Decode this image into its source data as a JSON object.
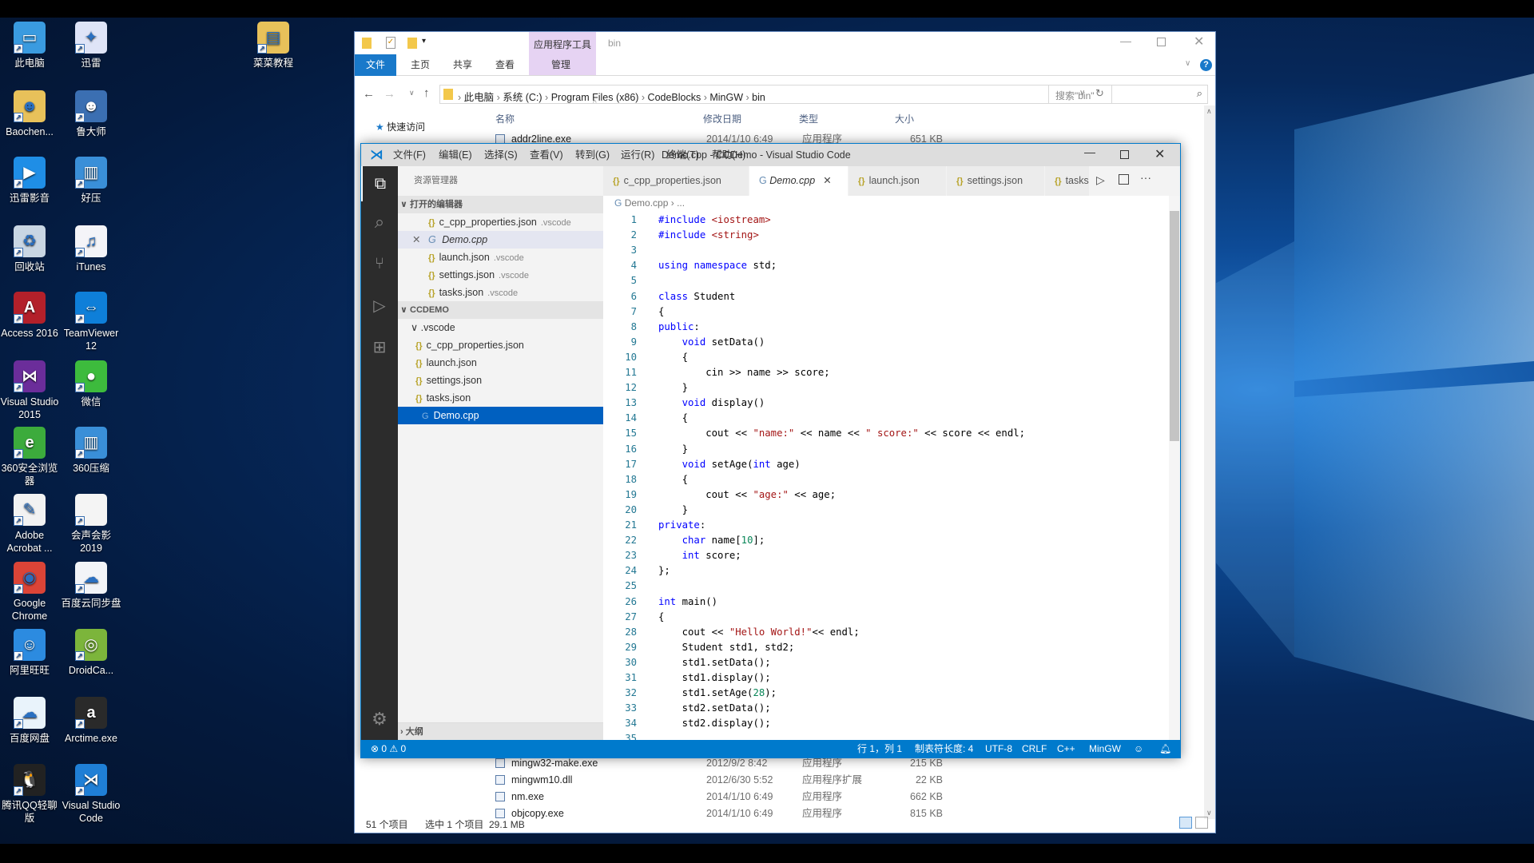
{
  "desktop": {
    "left_column": [
      {
        "label": "此电脑",
        "icon": "computer-icon",
        "color": "#3a9be0",
        "glyph": "▭"
      },
      {
        "label": "Baochen...",
        "icon": "user-folder-icon",
        "color": "#e8c15a",
        "glyph": "☻"
      },
      {
        "label": "迅雷影音",
        "icon": "xunlei-player-icon",
        "color": "#1f8ee6",
        "glyph": "▶"
      },
      {
        "label": "回收站",
        "icon": "recycle-bin-icon",
        "color": "#c9d6e3",
        "glyph": "♻"
      },
      {
        "label": "Access 2016",
        "icon": "access-icon",
        "color": "#b3202a",
        "glyph": "A"
      },
      {
        "label": "Visual Studio 2015",
        "icon": "visual-studio-icon",
        "color": "#6b2d9a",
        "glyph": "⋈"
      },
      {
        "label": "360安全浏览器",
        "icon": "360-browser-icon",
        "color": "#3cab3c",
        "glyph": "e"
      },
      {
        "label": "Adobe Acrobat ...",
        "icon": "acrobat-icon",
        "color": "#f2f2f2",
        "glyph": "✎"
      },
      {
        "label": "Google Chrome",
        "icon": "chrome-icon",
        "color": "#db4437",
        "glyph": "◉"
      },
      {
        "label": "阿里旺旺",
        "icon": "aliwangwang-icon",
        "color": "#2c8be0",
        "glyph": "☺"
      },
      {
        "label": "百度网盘",
        "icon": "baidu-netdisk-icon",
        "color": "#e9f3fb",
        "glyph": "☁"
      },
      {
        "label": "腾讯QQ轻聊版",
        "icon": "qq-icon",
        "color": "#222222",
        "glyph": "🐧"
      }
    ],
    "right_column": [
      {
        "label": "迅雷",
        "icon": "xunlei-icon",
        "color": "#dfe4f7",
        "glyph": "✦"
      },
      {
        "label": "鲁大师",
        "icon": "ludashi-icon",
        "color": "#3b6fb2",
        "glyph": "☻"
      },
      {
        "label": "好压",
        "icon": "haozip-icon",
        "color": "#3a8fd8",
        "glyph": "▥"
      },
      {
        "label": "iTunes",
        "icon": "itunes-icon",
        "color": "#f4f4f8",
        "glyph": "♫"
      },
      {
        "label": "TeamViewer 12",
        "icon": "teamviewer-icon",
        "color": "#0e7fd9",
        "glyph": "⇔"
      },
      {
        "label": "微信",
        "icon": "wechat-icon",
        "color": "#3dbb3d",
        "glyph": "●"
      },
      {
        "label": "360压缩",
        "icon": "360zip-icon",
        "color": "#3a8fd8",
        "glyph": "▥"
      },
      {
        "label": "会声会影 2019",
        "icon": "file-icon",
        "color": "#f4f4f4",
        "glyph": ""
      },
      {
        "label": "百度云同步盘",
        "icon": "baidu-sync-icon",
        "color": "#f2f4f8",
        "glyph": "☁"
      },
      {
        "label": "DroidCa...",
        "icon": "droidcam-icon",
        "color": "#7cb53b",
        "glyph": "◎"
      },
      {
        "label": "Arctime.exe",
        "icon": "arctime-icon",
        "color": "#2a2a2a",
        "glyph": "a"
      },
      {
        "label": "Visual Studio Code",
        "icon": "vscode-icon",
        "color": "#1f7fd6",
        "glyph": "⋊"
      }
    ],
    "extra": {
      "label": "菜菜教程",
      "icon": "folder-icon",
      "color": "#e8c15a",
      "glyph": "▤"
    }
  },
  "explorer": {
    "title": "bin",
    "context_tab": "应用程序工具",
    "ribbon_tabs": [
      "文件",
      "主页",
      "共享",
      "查看",
      "管理"
    ],
    "breadcrumb": [
      "此电脑",
      "系统 (C:)",
      "Program Files (x86)",
      "CodeBlocks",
      "MinGW",
      "bin"
    ],
    "search_placeholder": "搜索\"bin\"",
    "columns": [
      "名称",
      "修改日期",
      "类型",
      "大小"
    ],
    "nav": {
      "quick_access": "快速访问"
    },
    "rows_top": [
      {
        "name": "addr2line.exe",
        "date": "2014/1/10 6:49",
        "type": "应用程序",
        "size": "651 KB"
      }
    ],
    "rows_bottom": [
      {
        "name": "mingw32-make.exe",
        "date": "2012/9/2 8:42",
        "type": "应用程序",
        "size": "215 KB"
      },
      {
        "name": "mingwm10.dll",
        "date": "2012/6/30 5:52",
        "type": "应用程序扩展",
        "size": "22 KB"
      },
      {
        "name": "nm.exe",
        "date": "2014/1/10 6:49",
        "type": "应用程序",
        "size": "662 KB"
      },
      {
        "name": "objcopy.exe",
        "date": "2014/1/10 6:49",
        "type": "应用程序",
        "size": "815 KB"
      }
    ],
    "status": {
      "count": "51 个项目",
      "selected": "选中 1 个项目  29.1 MB"
    }
  },
  "vscode": {
    "title": "Demo.cpp - CCDemo - Visual Studio Code",
    "menu": [
      "文件(F)",
      "编辑(E)",
      "选择(S)",
      "查看(V)",
      "转到(G)",
      "运行(R)",
      "终端(T)",
      "帮助(H)"
    ],
    "sidebar": {
      "title": "资源管理器",
      "open_editors_header": "打开的编辑器",
      "open_editors": [
        {
          "name": "c_cpp_properties.json",
          "dir": ".vscode"
        },
        {
          "name": "Demo.cpp",
          "dir": ""
        },
        {
          "name": "launch.json",
          "dir": ".vscode"
        },
        {
          "name": "settings.json",
          "dir": ".vscode"
        },
        {
          "name": "tasks.json",
          "dir": ".vscode"
        }
      ],
      "folder_header": "CCDEMO",
      "subfolder": ".vscode",
      "files": [
        "c_cpp_properties.json",
        "launch.json",
        "settings.json",
        "tasks.json"
      ],
      "selected_file": "Demo.cpp",
      "outline_header": "大纲"
    },
    "tabs": [
      "c_cpp_properties.json",
      "Demo.cpp",
      "launch.json",
      "settings.json",
      "tasks.json"
    ],
    "active_tab": "Demo.cpp",
    "breadcrumb": [
      "Demo.cpp",
      "..."
    ],
    "code": [
      [
        [
          "pp",
          "#include"
        ],
        [
          "inc",
          " <iostream>"
        ]
      ],
      [
        [
          "pp",
          "#include"
        ],
        [
          "inc",
          " <string>"
        ]
      ],
      [],
      [
        [
          "kw",
          "using"
        ],
        [
          "",
          " "
        ],
        [
          "kw",
          "namespace"
        ],
        [
          "",
          " std;"
        ]
      ],
      [],
      [
        [
          "kw",
          "class"
        ],
        [
          "",
          " Student"
        ]
      ],
      [
        [
          "",
          "{"
        ]
      ],
      [
        [
          "kw",
          "public"
        ],
        [
          "",
          ":"
        ]
      ],
      [
        [
          "",
          "    "
        ],
        [
          "kw",
          "void"
        ],
        [
          "",
          " setData()"
        ]
      ],
      [
        [
          "",
          "    {"
        ]
      ],
      [
        [
          "",
          "        cin >> name >> score;"
        ]
      ],
      [
        [
          "",
          "    }"
        ]
      ],
      [
        [
          "",
          "    "
        ],
        [
          "kw",
          "void"
        ],
        [
          "",
          " display()"
        ]
      ],
      [
        [
          "",
          "    {"
        ]
      ],
      [
        [
          "",
          "        cout << "
        ],
        [
          "st",
          "\"name:\""
        ],
        [
          "",
          " << name << "
        ],
        [
          "st",
          "\" score:\""
        ],
        [
          "",
          " << score << endl;"
        ]
      ],
      [
        [
          "",
          "    }"
        ]
      ],
      [
        [
          "",
          "    "
        ],
        [
          "kw",
          "void"
        ],
        [
          "",
          " setAge("
        ],
        [
          "kw",
          "int"
        ],
        [
          "",
          " age)"
        ]
      ],
      [
        [
          "",
          "    {"
        ]
      ],
      [
        [
          "",
          "        cout << "
        ],
        [
          "st",
          "\"age:\""
        ],
        [
          "",
          " << age;"
        ]
      ],
      [
        [
          "",
          "    }"
        ]
      ],
      [
        [
          "kw",
          "private"
        ],
        [
          "",
          ":"
        ]
      ],
      [
        [
          "",
          "    "
        ],
        [
          "kw",
          "char"
        ],
        [
          "",
          " name["
        ],
        [
          "nm",
          "10"
        ],
        [
          "",
          "];"
        ]
      ],
      [
        [
          "",
          "    "
        ],
        [
          "kw",
          "int"
        ],
        [
          "",
          " score;"
        ]
      ],
      [
        [
          "",
          "};"
        ]
      ],
      [],
      [
        [
          "kw",
          "int"
        ],
        [
          "",
          " main()"
        ]
      ],
      [
        [
          "",
          "{"
        ]
      ],
      [
        [
          "",
          "    cout << "
        ],
        [
          "st",
          "\"Hello World!\""
        ],
        [
          "",
          "<< endl;"
        ]
      ],
      [
        [
          "",
          "    Student std1, std2;"
        ]
      ],
      [
        [
          "",
          "    std1.setData();"
        ]
      ],
      [
        [
          "",
          "    std1.display();"
        ]
      ],
      [
        [
          "",
          "    std1.setAge("
        ],
        [
          "nm",
          "28"
        ],
        [
          "",
          ");"
        ]
      ],
      [
        [
          "",
          "    std2.setData();"
        ]
      ],
      [
        [
          "",
          "    std2.display();"
        ]
      ],
      []
    ],
    "status": {
      "errors": "0",
      "warnings": "0",
      "position": "行 1，列 1",
      "tab_size": "制表符长度: 4",
      "encoding": "UTF-8",
      "eol": "CRLF",
      "language": "C++",
      "compiler": "MinGW"
    },
    "accent": "#007acc"
  }
}
